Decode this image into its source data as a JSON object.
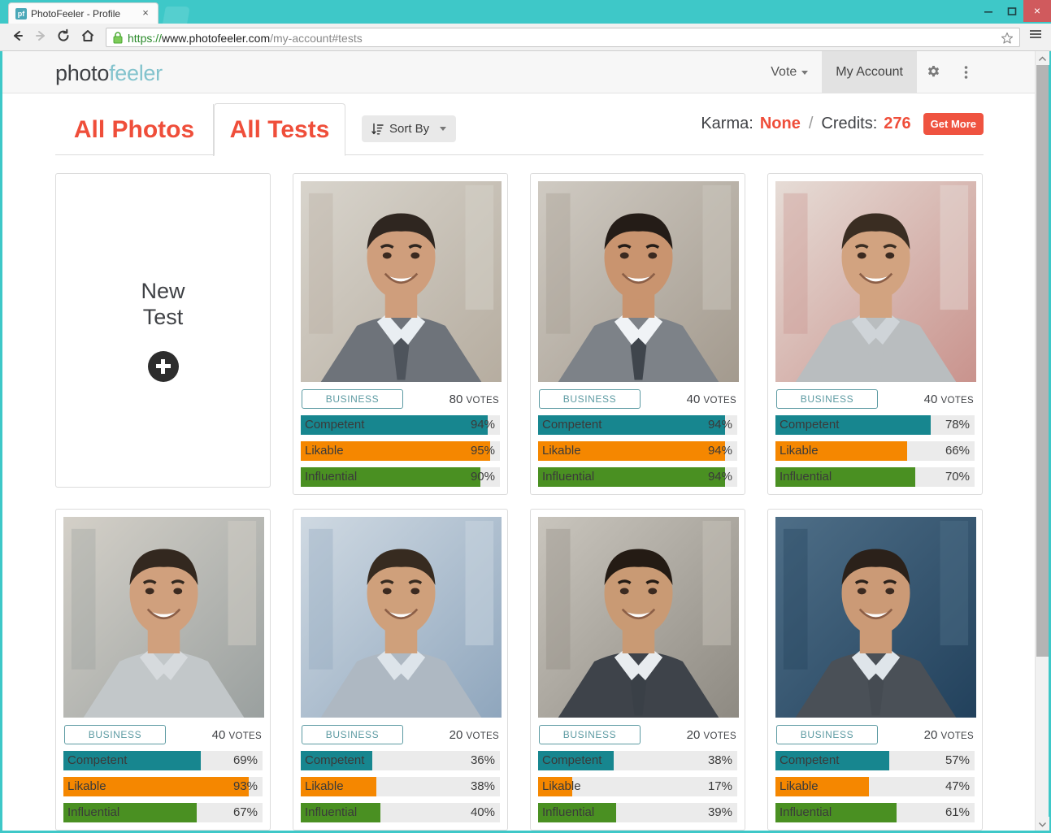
{
  "browser": {
    "tab_title": "PhotoFeeler - Profile",
    "favicon_text": "pf",
    "close_tab_glyph": "×",
    "url_scheme": "https://",
    "url_host": "www.photofeeler.com",
    "url_path": "/my-account#tests",
    "window_buttons": {
      "minimize": "minimize-icon",
      "maximize": "maximize-icon",
      "close": "×"
    },
    "nav": {
      "back": "back-arrow-icon",
      "forward": "forward-arrow-icon",
      "reload": "reload-icon",
      "home": "home-icon"
    },
    "lock_icon": "padlock-icon",
    "star_icon": "bookmark-star-icon",
    "menu_icon": "hamburger-menu-icon"
  },
  "site": {
    "logo_part1": "photo",
    "logo_part2": "feeler",
    "nav": [
      {
        "label": "Vote",
        "has_caret": true,
        "active": false
      },
      {
        "label": "My Account",
        "has_caret": false,
        "active": true
      }
    ],
    "gear_icon": "gear-icon",
    "more_icon": "vertical-dots-icon"
  },
  "tabs": [
    {
      "label": "All Photos",
      "active": false
    },
    {
      "label": "All Tests",
      "active": true
    }
  ],
  "sort": {
    "label": "Sort By",
    "icon": "sort-icon",
    "caret": true
  },
  "account": {
    "karma_label": "Karma:",
    "karma_value": "None",
    "separator": "/",
    "credits_label": "Credits:",
    "credits_value": "276",
    "get_more_label": "Get More"
  },
  "new_test": {
    "line1": "New",
    "line2": "Test",
    "plus_icon": "plus-circle-icon"
  },
  "colors": {
    "accent_red": "#ef4e3a",
    "competent": "#17868f",
    "likable": "#f58700",
    "influential": "#4a9022",
    "badge": "#5c9aa2",
    "track": "#ebebeb",
    "browser_frame": "#3ec8c8"
  },
  "trait_labels": [
    "Competent",
    "Likable",
    "Influential"
  ],
  "votes_word": "VOTES",
  "cards": [
    {
      "category": "BUSINESS",
      "votes": "80",
      "photo": "headshot-man-gray-suit-smiling",
      "scores": [
        {
          "trait": "Competent",
          "value": 94
        },
        {
          "trait": "Likable",
          "value": 95
        },
        {
          "trait": "Influential",
          "value": 90
        }
      ]
    },
    {
      "category": "BUSINESS",
      "votes": "40",
      "photo": "headshot-man-suit-tie-office",
      "scores": [
        {
          "trait": "Competent",
          "value": 94
        },
        {
          "trait": "Likable",
          "value": 94
        },
        {
          "trait": "Influential",
          "value": 94
        }
      ]
    },
    {
      "category": "BUSINESS",
      "votes": "40",
      "photo": "headshot-man-striped-shirt-red-wall",
      "scores": [
        {
          "trait": "Competent",
          "value": 78
        },
        {
          "trait": "Likable",
          "value": 66
        },
        {
          "trait": "Influential",
          "value": 70
        }
      ]
    },
    {
      "category": "BUSINESS",
      "votes": "40",
      "photo": "man-striped-shirt-standing-office",
      "scores": [
        {
          "trait": "Competent",
          "value": 69
        },
        {
          "trait": "Likable",
          "value": 93
        },
        {
          "trait": "Influential",
          "value": 67
        }
      ]
    },
    {
      "category": "BUSINESS",
      "votes": "20",
      "photo": "man-on-phone-at-desk",
      "scores": [
        {
          "trait": "Competent",
          "value": 36
        },
        {
          "trait": "Likable",
          "value": 38
        },
        {
          "trait": "Influential",
          "value": 40
        }
      ]
    },
    {
      "category": "BUSINESS",
      "votes": "20",
      "photo": "man-dark-suit-neutral-expression",
      "scores": [
        {
          "trait": "Competent",
          "value": 38
        },
        {
          "trait": "Likable",
          "value": 17
        },
        {
          "trait": "Influential",
          "value": 39
        }
      ]
    },
    {
      "category": "BUSINESS",
      "votes": "20",
      "photo": "man-suit-smiling-blue-background",
      "scores": [
        {
          "trait": "Competent",
          "value": 57
        },
        {
          "trait": "Likable",
          "value": 47
        },
        {
          "trait": "Influential",
          "value": 61
        }
      ]
    }
  ]
}
